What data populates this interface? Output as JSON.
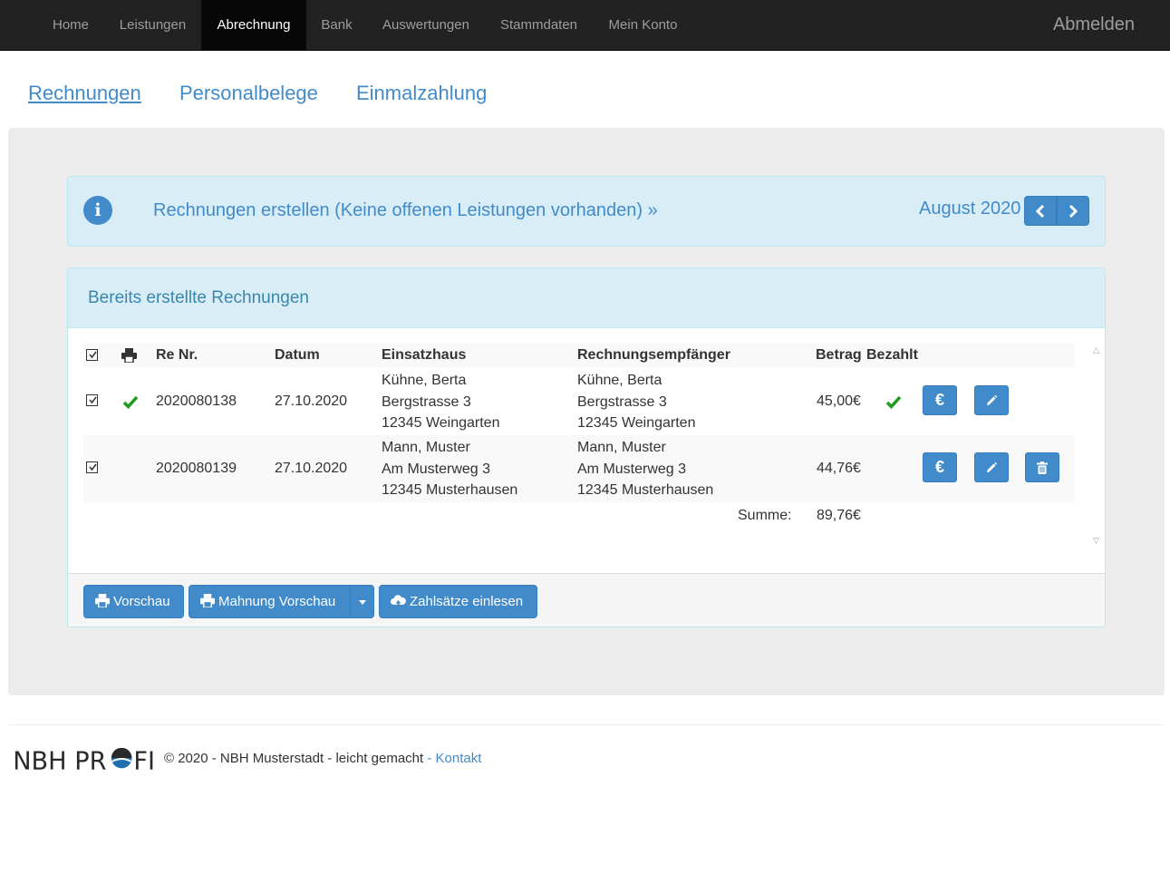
{
  "nav": {
    "items": [
      {
        "label": "Home"
      },
      {
        "label": "Leistungen"
      },
      {
        "label": "Abrechnung"
      },
      {
        "label": "Bank"
      },
      {
        "label": "Auswertungen"
      },
      {
        "label": "Stammdaten"
      },
      {
        "label": "Mein Konto"
      }
    ],
    "active": "Abrechnung",
    "logout_label": "Abmelden"
  },
  "subtabs": [
    {
      "label": "Rechnungen"
    },
    {
      "label": "Personalbelege"
    },
    {
      "label": "Einmalzahlung"
    }
  ],
  "info_alert": {
    "icon": "info-icon",
    "icon_glyph": "i",
    "link_text": "Rechnungen erstellen (Keine offenen Leistungen vorhanden) »",
    "month_label": "August 2020"
  },
  "panel": {
    "title": "Bereits erstellte Rechnungen",
    "table": {
      "headers": {
        "re_nr": "Re Nr.",
        "datum": "Datum",
        "einsatzhaus": "Einsatzhaus",
        "empfaenger": "Rechnungsempfänger",
        "betrag": "Betrag",
        "bezahlt": "Bezahlt"
      },
      "rows": [
        {
          "re_nr": "2020080138",
          "datum": "27.10.2020",
          "einsatzhaus": [
            "Kühne, Berta",
            "Bergstrasse 3",
            "12345 Weingarten"
          ],
          "empfaenger": [
            "Kühne, Berta",
            "Bergstrasse 3",
            "12345 Weingarten"
          ],
          "betrag": "45,00€",
          "printed": true,
          "paid": true,
          "deletable": false
        },
        {
          "re_nr": "2020080139",
          "datum": "27.10.2020",
          "einsatzhaus": [
            "Mann, Muster",
            "Am Musterweg 3",
            "12345 Musterhausen"
          ],
          "empfaenger": [
            "Mann, Muster",
            "Am Musterweg 3",
            "12345 Musterhausen"
          ],
          "betrag": "44,76€",
          "printed": false,
          "paid": false,
          "deletable": true
        }
      ],
      "sum_label": "Summe:",
      "sum_value": "89,76€",
      "euro_glyph": "€"
    },
    "footer_buttons": {
      "vorschau": "Vorschau",
      "mahnung_vorschau": "Mahnung Vorschau",
      "zahlsaetze": "Zahlsätze einlesen"
    }
  },
  "footer": {
    "logo_text_left": "NBH PR",
    "logo_text_right": "FI",
    "copyright": "© 2020 - NBH Musterstadt - leicht gemacht",
    "separator": " - ",
    "contact_label": "Kontakt"
  },
  "colors": {
    "navbar": "#222222",
    "primary": "#428bca",
    "info_bg": "#d9edf7",
    "success": "#1c9b1c"
  }
}
